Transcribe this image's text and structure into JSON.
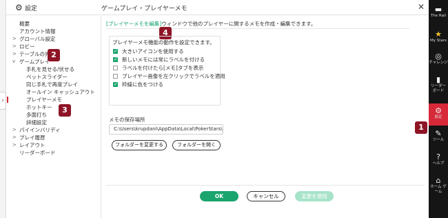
{
  "window": {
    "app_title": "設定",
    "page_title": "ゲームプレイ・プレイヤーメモ",
    "close": "✕"
  },
  "sidebar": {
    "items": [
      {
        "label": "概要",
        "arrow": ""
      },
      {
        "label": "アカウント情報",
        "arrow": ""
      },
      {
        "label": "グローバル設定",
        "arrow": ">"
      },
      {
        "label": "ロビー",
        "arrow": ">"
      },
      {
        "label": "テーブルの外観",
        "arrow": ">"
      },
      {
        "label": "ゲームプレイ",
        "arrow": "v"
      },
      {
        "label": "手札を見せる/伏せる",
        "arrow": ""
      },
      {
        "label": "ベットスライダー",
        "arrow": ""
      },
      {
        "label": "同じ手札で再度プレイ",
        "arrow": ""
      },
      {
        "label": "オールイン キャッシュアウト",
        "arrow": ""
      },
      {
        "label": "プレイヤーメモ",
        "arrow": ""
      },
      {
        "label": "ホットキー",
        "arrow": ""
      },
      {
        "label": "多面打ち",
        "arrow": ""
      },
      {
        "label": "詳細設定",
        "arrow": ""
      },
      {
        "label": "パイインバリディ",
        "arrow": ">"
      },
      {
        "label": "プレイ履歴",
        "arrow": ">"
      },
      {
        "label": "レイアウト",
        "arrow": ">"
      },
      {
        "label": "リーダーボード",
        "arrow": ""
      }
    ]
  },
  "content": {
    "desc_highlight": "[プレイヤーメモを編集]",
    "desc_rest": "ウィンドウで他のプレイヤーに関するメモを作成・編集できます。",
    "group_title": "プレイヤーメモ機能の動作を設定できます。",
    "options": [
      {
        "label": "大きいアイコンを使用する",
        "checked": true
      },
      {
        "label": "新しいメモには常にラベルを付ける",
        "checked": true
      },
      {
        "label": "ラベルを付けたら[メモ]タブを表示",
        "checked": false
      },
      {
        "label": "プレイヤー画像を左クリックでラベルを適用",
        "checked": false
      },
      {
        "label": "枠線に色をつける",
        "checked": true
      }
    ],
    "save_location_label": "メモの保存場所",
    "save_path": "C:\\Users\\krupdani\\AppData\\Local\\PokerStars\\",
    "change_folder_btn": "フォルダーを変更する",
    "open_folder_btn": "フォルダーを開く"
  },
  "footer": {
    "ok": "OK",
    "cancel": "キャンセル",
    "apply": "変更を適用"
  },
  "badges": {
    "b1": "1",
    "b2": "2",
    "b3": "3",
    "b4": "4"
  },
  "right_panel": [
    {
      "icon": "▬",
      "label": "The Rail",
      "icon_name": "rail-icon"
    },
    {
      "icon": "★",
      "label": "My Stars",
      "icon_name": "star-icon"
    },
    {
      "icon": "◎",
      "label": "チャレンジ",
      "icon_name": "challenge-icon"
    },
    {
      "icon": "▮",
      "label": "リーダー ボード",
      "icon_name": "leaderboard-icon"
    },
    {
      "icon": "⚙",
      "label": "設定",
      "icon_name": "settings-icon",
      "active": true
    },
    {
      "icon": "✎",
      "label": "ツール",
      "icon_name": "wrench-icon"
    },
    {
      "icon": "?",
      "label": "ヘルプ",
      "icon_name": "help-icon"
    },
    {
      "icon": "⌂",
      "label": "ホーム ゲーム",
      "icon_name": "home-game-icon"
    }
  ],
  "colors": {
    "accent": "#1aa46e",
    "active": "#d8293a",
    "badge": "#8e1426"
  }
}
